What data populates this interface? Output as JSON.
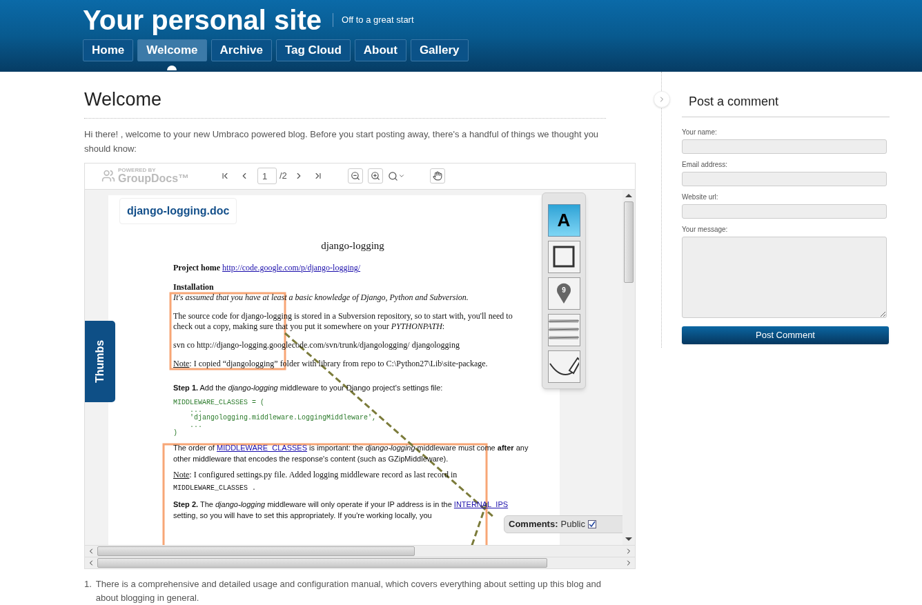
{
  "site": {
    "title": "Your personal site",
    "tagline": "Off to a great start"
  },
  "nav": [
    {
      "label": "Home",
      "selected": false
    },
    {
      "label": "Welcome",
      "selected": true
    },
    {
      "label": "Archive",
      "selected": false
    },
    {
      "label": "Tag Cloud",
      "selected": false
    },
    {
      "label": "About",
      "selected": false
    },
    {
      "label": "Gallery",
      "selected": false
    }
  ],
  "article": {
    "heading": "Welcome",
    "intro": "Hi there! , welcome to your new Umbraco powered blog. Before you start posting away, there's a handful of things we thought you should know:",
    "viewer": {
      "logo_small": "POWERED BY",
      "logo": "GroupDocs™",
      "page_input": "1",
      "page_total": "/2",
      "file_name": "django-logging.doc",
      "thumbs_tab": "Thumbs",
      "blocks": [
        {
          "kind": "title",
          "text": "django-logging"
        },
        {
          "kind": "link_line",
          "label": "Project home",
          "link": "http://code.google.com/p/django-logging/"
        },
        {
          "kind": "heading",
          "text": "Installation"
        },
        {
          "kind": "italic",
          "text": "It's assumed that you have at least a basic knowledge of Django, Python and Subversion."
        },
        {
          "kind": "serif",
          "text": "The source code for django-logging is stored in a Subversion repository, so to start with, you'll need to check out a copy, making sure that you put it somewhere on your *PYTHONPATH*:"
        },
        {
          "kind": "serif",
          "text": "svn co http://django-logging.googlecode.com/svn/trunk/djangologging/ djangologging"
        },
        {
          "kind": "note",
          "label": "Note",
          "text": ":  I copied “djangologging” folder with library from repo to C:\\Python27\\Lib\\site-package."
        },
        {
          "kind": "sans",
          "text": "**Step 1.** Add the *django-logging* middleware to your Django project's settings file:"
        },
        {
          "kind": "code",
          "lines": [
            "MIDDLEWARE_CLASSES = (",
            "    ...",
            "    'djangologging.middleware.LoggingMiddleware',",
            "    ...",
            ")"
          ]
        },
        {
          "kind": "sans_link",
          "before": "The order of ",
          "link": "MIDDLEWARE_CLASSES",
          "after": " is important: the *django-logging* middleware must come **after** any other middleware that encodes the response's content (such as GZipMiddleware)."
        },
        {
          "kind": "note",
          "label": "Note",
          "text": ":  I configured settings.py file. Added logging middleware record as last record in"
        },
        {
          "kind": "code_inline",
          "text": "MIDDLEWARE_CLASSES ."
        },
        {
          "kind": "sans_link",
          "before": "**Step 2.** The *django-logging* middleware will only operate if your IP address is in the ",
          "link": "INTERNAL_IPS",
          "after": " setting, so you will have to set this appropriately. If you're working locally, you"
        }
      ],
      "tools": [
        {
          "kind": "text",
          "label": "A",
          "selected": true
        },
        {
          "kind": "area",
          "selected": false
        },
        {
          "kind": "point",
          "badge": "9",
          "selected": false
        },
        {
          "kind": "strikeout",
          "selected": false
        },
        {
          "kind": "draw",
          "selected": false
        }
      ],
      "comments": {
        "label": "Comments:",
        "value": "Public",
        "checked": true
      }
    },
    "list": [
      {
        "marker": "1.",
        "text": "There is a comprehensive and detailed usage and configuration manual, which covers everything about setting up this blog and about blogging in general."
      }
    ]
  },
  "sidebar": {
    "heading": "Post a comment",
    "fields": [
      {
        "label": "Your name:",
        "kind": "input"
      },
      {
        "label": "Email address:",
        "kind": "input"
      },
      {
        "label": "Website url:",
        "kind": "input"
      },
      {
        "label": "Your message:",
        "kind": "textarea"
      }
    ],
    "button": "Post Comment"
  }
}
